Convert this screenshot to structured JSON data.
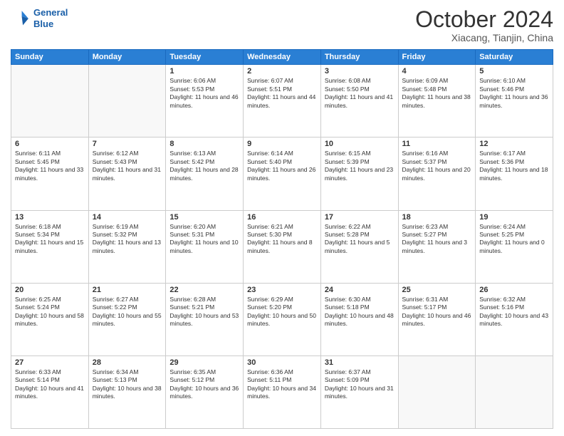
{
  "header": {
    "logo_line1": "General",
    "logo_line2": "Blue",
    "month_title": "October 2024",
    "location": "Xiacang, Tianjin, China"
  },
  "days_of_week": [
    "Sunday",
    "Monday",
    "Tuesday",
    "Wednesday",
    "Thursday",
    "Friday",
    "Saturday"
  ],
  "weeks": [
    [
      {
        "day": "",
        "info": ""
      },
      {
        "day": "",
        "info": ""
      },
      {
        "day": "1",
        "info": "Sunrise: 6:06 AM\nSunset: 5:53 PM\nDaylight: 11 hours and 46 minutes."
      },
      {
        "day": "2",
        "info": "Sunrise: 6:07 AM\nSunset: 5:51 PM\nDaylight: 11 hours and 44 minutes."
      },
      {
        "day": "3",
        "info": "Sunrise: 6:08 AM\nSunset: 5:50 PM\nDaylight: 11 hours and 41 minutes."
      },
      {
        "day": "4",
        "info": "Sunrise: 6:09 AM\nSunset: 5:48 PM\nDaylight: 11 hours and 38 minutes."
      },
      {
        "day": "5",
        "info": "Sunrise: 6:10 AM\nSunset: 5:46 PM\nDaylight: 11 hours and 36 minutes."
      }
    ],
    [
      {
        "day": "6",
        "info": "Sunrise: 6:11 AM\nSunset: 5:45 PM\nDaylight: 11 hours and 33 minutes."
      },
      {
        "day": "7",
        "info": "Sunrise: 6:12 AM\nSunset: 5:43 PM\nDaylight: 11 hours and 31 minutes."
      },
      {
        "day": "8",
        "info": "Sunrise: 6:13 AM\nSunset: 5:42 PM\nDaylight: 11 hours and 28 minutes."
      },
      {
        "day": "9",
        "info": "Sunrise: 6:14 AM\nSunset: 5:40 PM\nDaylight: 11 hours and 26 minutes."
      },
      {
        "day": "10",
        "info": "Sunrise: 6:15 AM\nSunset: 5:39 PM\nDaylight: 11 hours and 23 minutes."
      },
      {
        "day": "11",
        "info": "Sunrise: 6:16 AM\nSunset: 5:37 PM\nDaylight: 11 hours and 20 minutes."
      },
      {
        "day": "12",
        "info": "Sunrise: 6:17 AM\nSunset: 5:36 PM\nDaylight: 11 hours and 18 minutes."
      }
    ],
    [
      {
        "day": "13",
        "info": "Sunrise: 6:18 AM\nSunset: 5:34 PM\nDaylight: 11 hours and 15 minutes."
      },
      {
        "day": "14",
        "info": "Sunrise: 6:19 AM\nSunset: 5:32 PM\nDaylight: 11 hours and 13 minutes."
      },
      {
        "day": "15",
        "info": "Sunrise: 6:20 AM\nSunset: 5:31 PM\nDaylight: 11 hours and 10 minutes."
      },
      {
        "day": "16",
        "info": "Sunrise: 6:21 AM\nSunset: 5:30 PM\nDaylight: 11 hours and 8 minutes."
      },
      {
        "day": "17",
        "info": "Sunrise: 6:22 AM\nSunset: 5:28 PM\nDaylight: 11 hours and 5 minutes."
      },
      {
        "day": "18",
        "info": "Sunrise: 6:23 AM\nSunset: 5:27 PM\nDaylight: 11 hours and 3 minutes."
      },
      {
        "day": "19",
        "info": "Sunrise: 6:24 AM\nSunset: 5:25 PM\nDaylight: 11 hours and 0 minutes."
      }
    ],
    [
      {
        "day": "20",
        "info": "Sunrise: 6:25 AM\nSunset: 5:24 PM\nDaylight: 10 hours and 58 minutes."
      },
      {
        "day": "21",
        "info": "Sunrise: 6:27 AM\nSunset: 5:22 PM\nDaylight: 10 hours and 55 minutes."
      },
      {
        "day": "22",
        "info": "Sunrise: 6:28 AM\nSunset: 5:21 PM\nDaylight: 10 hours and 53 minutes."
      },
      {
        "day": "23",
        "info": "Sunrise: 6:29 AM\nSunset: 5:20 PM\nDaylight: 10 hours and 50 minutes."
      },
      {
        "day": "24",
        "info": "Sunrise: 6:30 AM\nSunset: 5:18 PM\nDaylight: 10 hours and 48 minutes."
      },
      {
        "day": "25",
        "info": "Sunrise: 6:31 AM\nSunset: 5:17 PM\nDaylight: 10 hours and 46 minutes."
      },
      {
        "day": "26",
        "info": "Sunrise: 6:32 AM\nSunset: 5:16 PM\nDaylight: 10 hours and 43 minutes."
      }
    ],
    [
      {
        "day": "27",
        "info": "Sunrise: 6:33 AM\nSunset: 5:14 PM\nDaylight: 10 hours and 41 minutes."
      },
      {
        "day": "28",
        "info": "Sunrise: 6:34 AM\nSunset: 5:13 PM\nDaylight: 10 hours and 38 minutes."
      },
      {
        "day": "29",
        "info": "Sunrise: 6:35 AM\nSunset: 5:12 PM\nDaylight: 10 hours and 36 minutes."
      },
      {
        "day": "30",
        "info": "Sunrise: 6:36 AM\nSunset: 5:11 PM\nDaylight: 10 hours and 34 minutes."
      },
      {
        "day": "31",
        "info": "Sunrise: 6:37 AM\nSunset: 5:09 PM\nDaylight: 10 hours and 31 minutes."
      },
      {
        "day": "",
        "info": ""
      },
      {
        "day": "",
        "info": ""
      }
    ]
  ]
}
